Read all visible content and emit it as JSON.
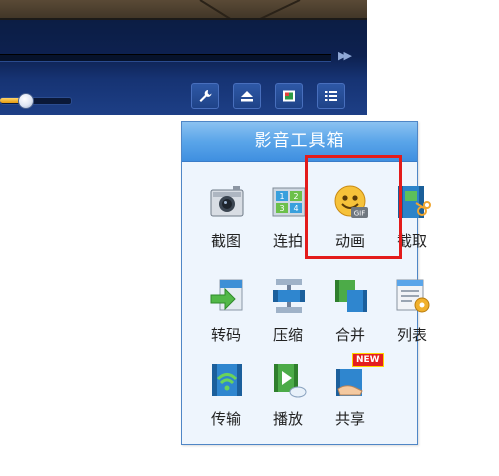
{
  "toolbox": {
    "title": "影音工具箱",
    "tools": [
      {
        "label": "截图",
        "icon": "camera-icon"
      },
      {
        "label": "连拍",
        "icon": "burst-grid-icon"
      },
      {
        "label": "动画",
        "icon": "gif-smiley-icon",
        "highlighted": true
      },
      {
        "label": "截取",
        "icon": "film-scissors-icon"
      },
      {
        "label": "转码",
        "icon": "convert-arrow-icon"
      },
      {
        "label": "压缩",
        "icon": "compress-clamp-icon"
      },
      {
        "label": "合并",
        "icon": "merge-film-icon"
      },
      {
        "label": "列表",
        "icon": "list-gear-icon"
      },
      {
        "label": "传输",
        "icon": "wifi-film-icon"
      },
      {
        "label": "播放",
        "icon": "play-cloud-icon"
      },
      {
        "label": "共享",
        "icon": "share-hand-icon",
        "badge": "NEW"
      }
    ]
  },
  "player": {
    "toolbar_buttons": [
      "wrench-icon",
      "eject-icon",
      "screen-icon",
      "list-icon"
    ],
    "volume_fraction": 0.35,
    "fast_forward_icon": "fast-forward-icon"
  },
  "colors": {
    "highlight": "#e31b1b",
    "header": "#5aa5e9",
    "panel_bg": "#eef5fd",
    "player_bg": "#0d2150"
  }
}
